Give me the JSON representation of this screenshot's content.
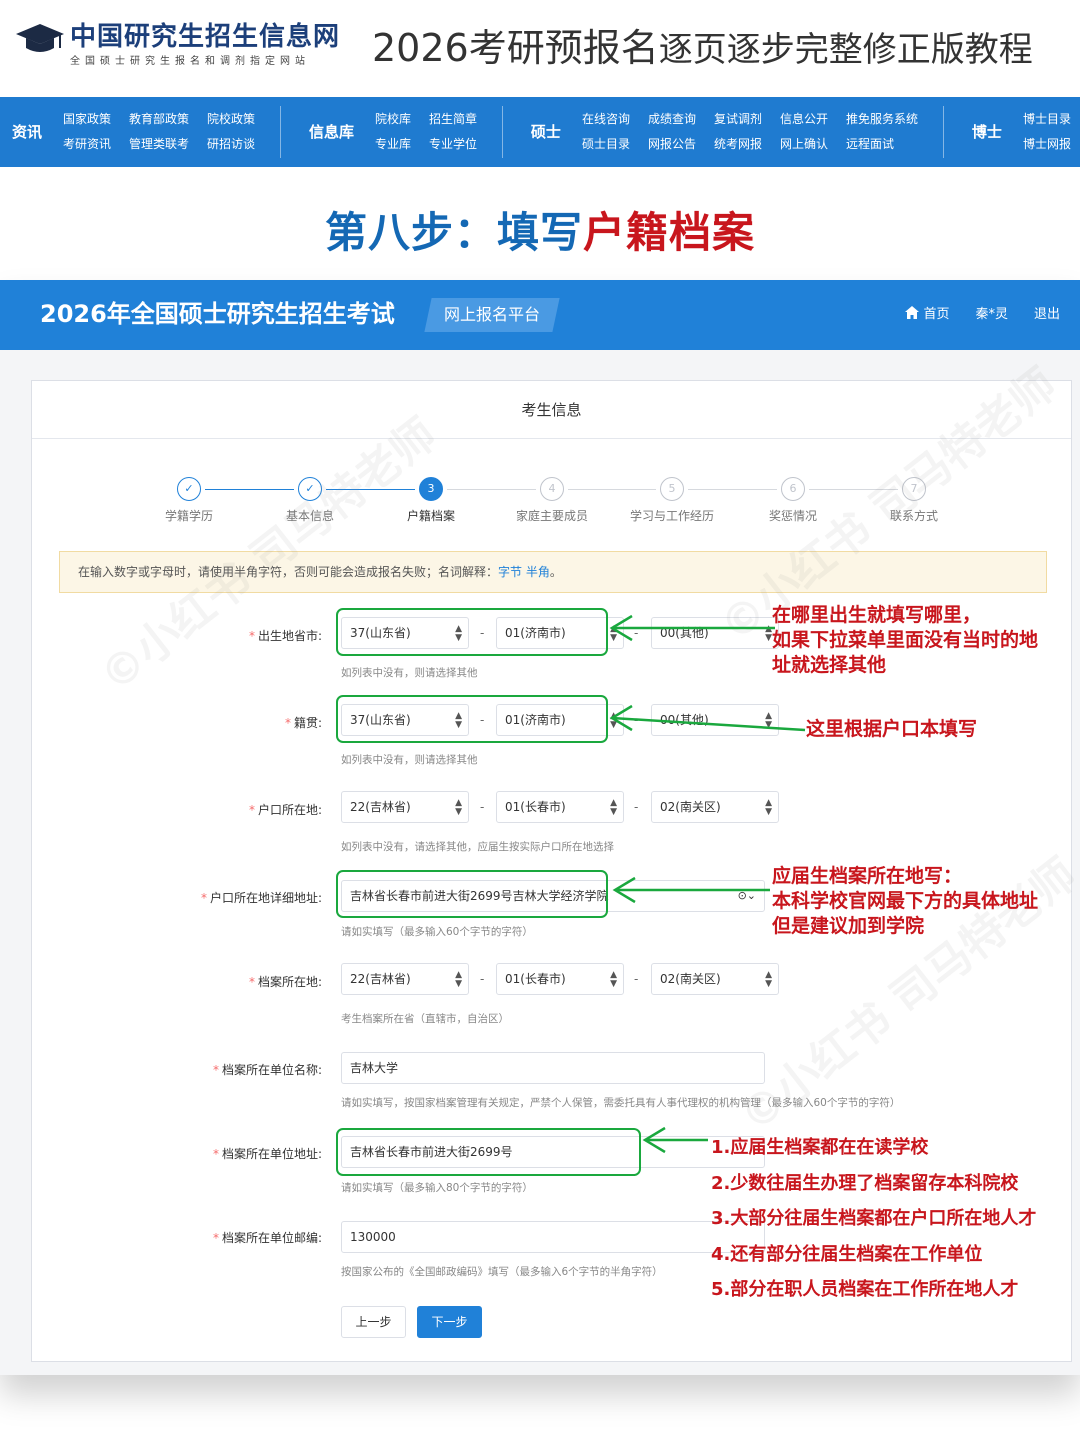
{
  "header": {
    "logo_name": "中国研究生招生信息网",
    "logo_sub": "全国硕士研究生报名和调剂指定网站",
    "tutorial_title_a": "2026考研",
    "tutorial_title_b": "预报名",
    "tutorial_title_c": "逐页逐步完整修正版教程"
  },
  "nav": {
    "groups": [
      {
        "section": "资讯",
        "cols": [
          [
            "国家政策",
            "考研资讯"
          ],
          [
            "教育部政策",
            "管理类联考"
          ],
          [
            "院校政策",
            "研招访谈"
          ]
        ]
      },
      {
        "section": "信息库",
        "cols": [
          [
            "院校库",
            "专业库"
          ],
          [
            "招生简章",
            "专业学位"
          ]
        ]
      },
      {
        "section": "硕士",
        "cols": [
          [
            "在线咨询",
            "硕士目录"
          ],
          [
            "成绩查询",
            "网报公告"
          ],
          [
            "复试调剂",
            "统考网报"
          ],
          [
            "信息公开",
            "网上确认"
          ],
          [
            "推免服务系统",
            "远程面试"
          ]
        ]
      },
      {
        "section": "博士",
        "cols": [
          [
            "博士目录",
            "博士网报"
          ]
        ]
      }
    ]
  },
  "step_heading": {
    "part1": "第八步：填写",
    "part2": "户籍档案"
  },
  "portal": {
    "title": "2026年全国硕士研究生招生考试",
    "tag": "网上报名平台",
    "home": "首页",
    "user": "秦*灵",
    "logout": "退出",
    "card_title": "考生信息",
    "steps": [
      {
        "num": "1",
        "label": "学籍学历",
        "state": "done"
      },
      {
        "num": "2",
        "label": "基本信息",
        "state": "done"
      },
      {
        "num": "3",
        "label": "户籍档案",
        "state": "current"
      },
      {
        "num": "4",
        "label": "家庭主要成员",
        "state": "todo"
      },
      {
        "num": "5",
        "label": "学习与工作经历",
        "state": "todo"
      },
      {
        "num": "6",
        "label": "奖惩情况",
        "state": "todo"
      },
      {
        "num": "7",
        "label": "联系方式",
        "state": "todo"
      }
    ],
    "notice_text": "在输入数字或字母时，请使用半角字符，否则可能会造成报名失败；名词解释：",
    "notice_link1": "字节",
    "notice_link2": "半角",
    "notice_end": "。",
    "form": {
      "birthplace": {
        "label": "出生地省市:",
        "v1": "37(山东省)",
        "v2": "01(济南市)",
        "v3": "00(其他)",
        "hint": "如列表中没有，则请选择其他"
      },
      "native": {
        "label": "籍贯:",
        "v1": "37(山东省)",
        "v2": "01(济南市)",
        "v3": "00(其他)",
        "hint": "如列表中没有，则请选择其他"
      },
      "hukou": {
        "label": "户口所在地:",
        "v1": "22(吉林省)",
        "v2": "01(长春市)",
        "v3": "02(南关区)",
        "hint": "如列表中没有，请选择其他，应届生按实际户口所在地选择"
      },
      "hukou_addr": {
        "label": "户口所在地详细地址:",
        "value": "吉林省长春市前进大街2699号吉林大学经济学院",
        "hint": "请如实填写（最多输入60个字节的字符）"
      },
      "archive": {
        "label": "档案所在地:",
        "v1": "22(吉林省)",
        "v2": "01(长春市)",
        "v3": "02(南关区)",
        "hint": "考生档案所在省（直辖市，自治区）"
      },
      "archive_unit": {
        "label": "档案所在单位名称:",
        "value": "吉林大学",
        "hint": "请如实填写，按国家档案管理有关规定，严禁个人保管，需委托具有人事代理权的机构管理（最多输入60个字节的字符）"
      },
      "archive_addr": {
        "label": "档案所在单位地址:",
        "value": "吉林省长春市前进大街2699号",
        "hint": "请如实填写（最多输入80个字节的字符）"
      },
      "archive_zip": {
        "label": "档案所在单位邮编:",
        "value": "130000",
        "hint": "按国家公布的《全国邮政编码》填写（最多输入6个字节的半角字符）"
      }
    },
    "btn_prev": "上一步",
    "btn_next": "下一步"
  },
  "annotations": {
    "birth": [
      "在哪里出生就填写哪里，",
      "如果下拉菜单里面没有当时的地",
      "址就选择其他"
    ],
    "native": "这里根据户口本填写",
    "hukou_addr": [
      "应届生档案所在地写：",
      "本科学校官网最下方的具体地址",
      "但是建议加到学院"
    ],
    "archive": [
      "1.应届生档案都在在读学校",
      "2.少数往届生办理了档案留存本科院校",
      "3.大部分往届生档案都在户口所在地人才",
      "4.还有部分往届生档案在工作单位",
      "5.部分在职人员档案在工作所在地人才"
    ]
  },
  "watermark": "©小红书 司马特老师",
  "colors": {
    "brand_blue": "#2081d8",
    "annotation_red": "#c8161d",
    "annotation_green": "#1aa83e"
  }
}
